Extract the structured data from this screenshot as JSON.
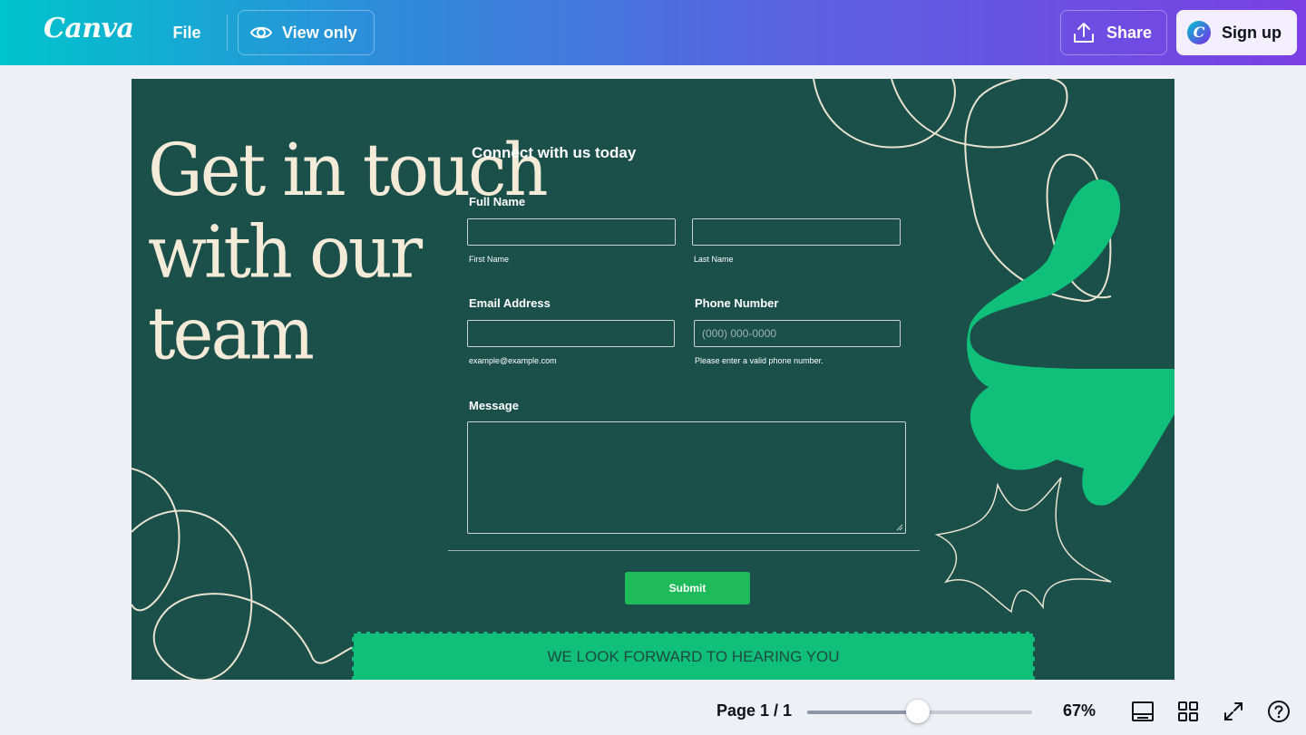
{
  "topbar": {
    "logo": "Canva",
    "file_label": "File",
    "view_only_label": "View only",
    "share_label": "Share",
    "signup_label": "Sign up",
    "icons": {
      "view": "eye-icon",
      "share": "upload-share-icon",
      "signup": "canva-logo-icon"
    }
  },
  "design": {
    "headline": [
      "Get in touch",
      "with our",
      "team"
    ],
    "form_title": "Connect with us today",
    "full_name_label": "Full Name",
    "first_name_sublabel": "First Name",
    "last_name_sublabel": "Last Name",
    "email_label": "Email Address",
    "email_hint": "example@example.com",
    "phone_label": "Phone Number",
    "phone_placeholder": "(000) 000-0000",
    "phone_hint": "Please enter a valid phone number.",
    "message_label": "Message",
    "submit_label": "Submit",
    "footer_text": "WE LOOK FORWARD TO HEARING YOU",
    "colors": {
      "background": "#1a4f4a",
      "accent_green": "#0fbf7a",
      "submit_green": "#1fbb5a",
      "headline": "#f3ead8"
    }
  },
  "bottombar": {
    "page_indicator": "Page 1 / 1",
    "zoom_level": "67%",
    "zoom_fraction": 0.49,
    "icons": [
      "notes-layout-icon",
      "grid-view-icon",
      "fullscreen-icon",
      "help-icon"
    ]
  }
}
